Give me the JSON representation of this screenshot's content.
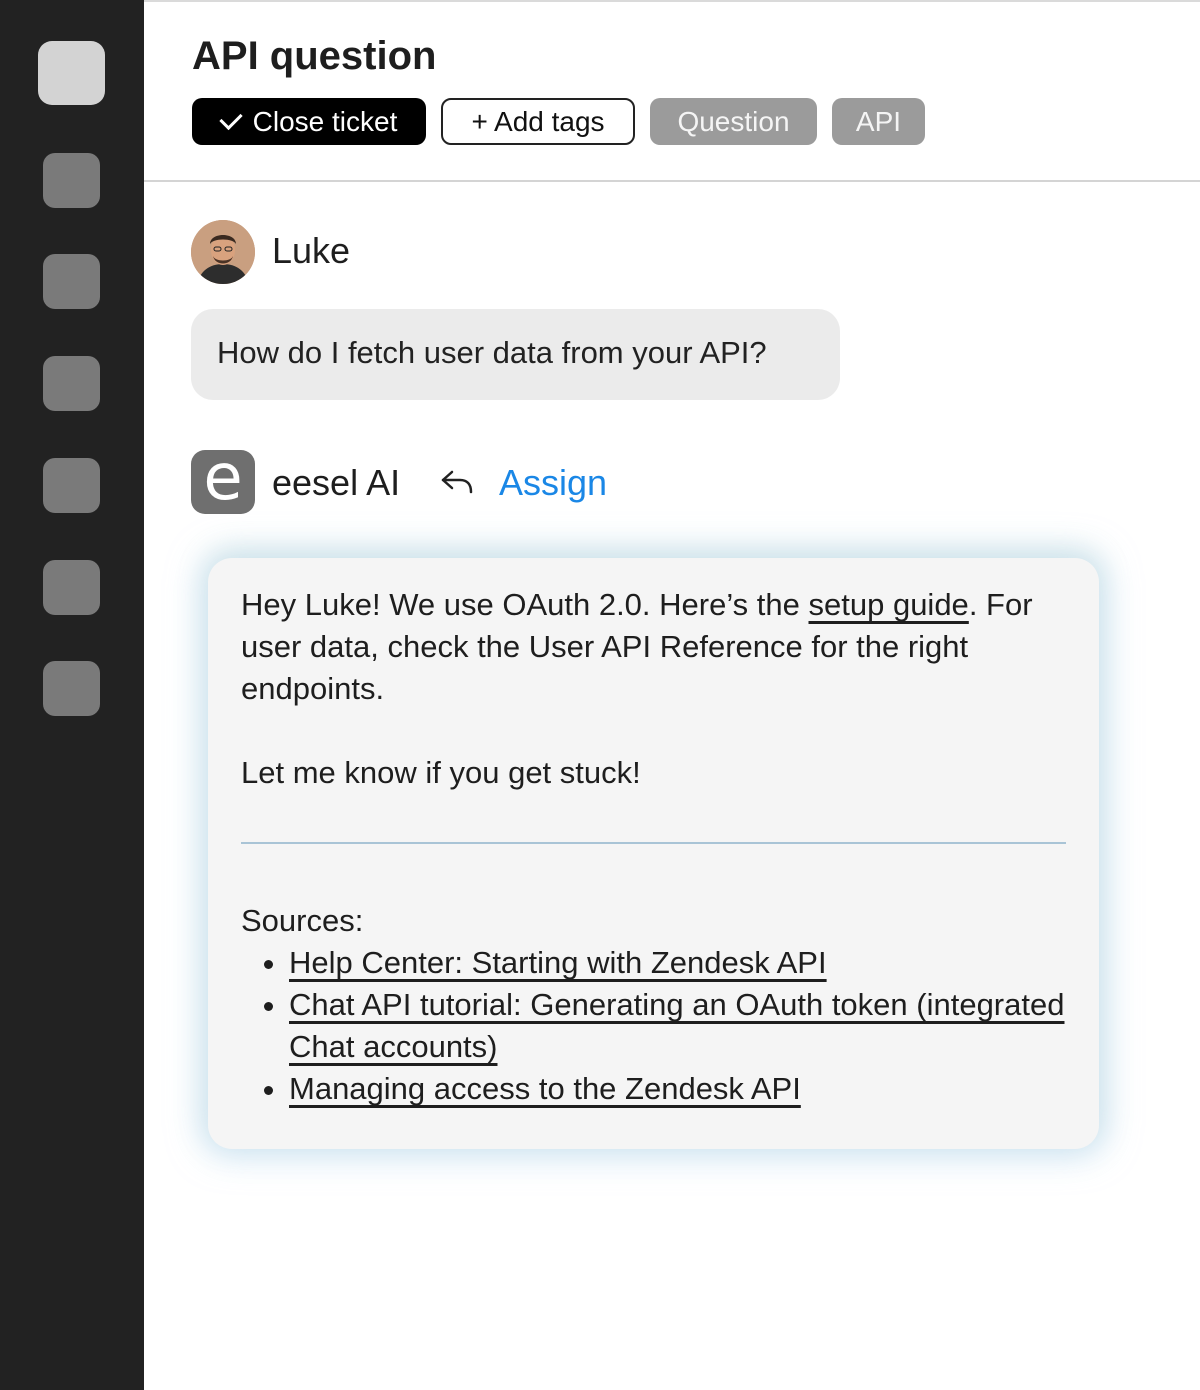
{
  "sidebar": {
    "items": [
      "nav-1",
      "nav-2",
      "nav-3",
      "nav-4",
      "nav-5",
      "nav-6",
      "nav-7"
    ]
  },
  "ticket": {
    "title": "API question",
    "close_label": "Close ticket",
    "add_tags_label": "+ Add tags",
    "tags": [
      "Question",
      "API"
    ]
  },
  "customer": {
    "name": "Luke",
    "message": "How do I fetch user data from your API?"
  },
  "ai": {
    "logo_letter": "e",
    "name": "eesel AI",
    "assign_label": "Assign",
    "reply_pre": "Hey Luke! We use OAuth 2.0. Here’s the ",
    "reply_link": "setup guide",
    "reply_post": ". For user data, check the User API Reference for the right endpoints.",
    "reply_2": "Let me know if you get stuck!",
    "sources_label": "Sources:",
    "sources": [
      "Help Center: Starting with Zendesk API",
      "Chat API tutorial: Generating an OAuth token (integrated Chat accounts)",
      "Managing access to the Zendesk API"
    ]
  },
  "colors": {
    "sidebar_bg": "#222222",
    "accent": "#1a87e6",
    "tag_bg": "#9b9b9b"
  }
}
